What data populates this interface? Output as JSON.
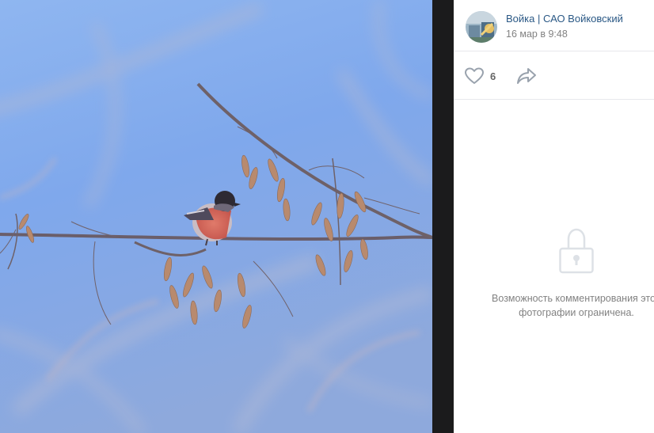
{
  "photo": {
    "description_icon": "bullfinch-photo"
  },
  "post": {
    "author_name": "Войка | САО Войковский",
    "date": "16 мар в 9:48",
    "avatar_icon": "community-avatar"
  },
  "actions": {
    "like_icon": "heart-icon",
    "like_count": "6",
    "share_icon": "share-arrow-icon"
  },
  "comments": {
    "lock_icon": "padlock-icon",
    "restricted_line1": "Возможность комментирования этой",
    "restricted_line2": "фотографии ограничена."
  },
  "colors": {
    "link": "#2a5885",
    "secondary_text": "#828282",
    "icon": "#99a2ad",
    "divider": "#e7e8ec"
  }
}
